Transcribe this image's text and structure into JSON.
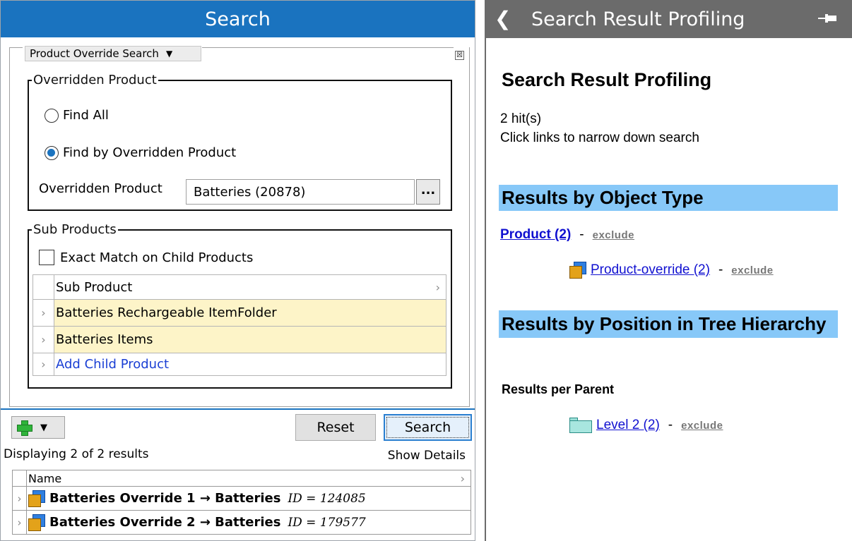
{
  "search_panel": {
    "header_title": "Search",
    "query_type": "Product Override Search",
    "close_glyph": "☒",
    "overridden_group": {
      "legend": "Overridden Product",
      "find_all_label": "Find All",
      "find_by_label": "Find by Overridden Product",
      "selected_option": "Find by Overridden Product",
      "field_label": "Overridden Product",
      "field_value": "Batteries (20878)",
      "browse_label": "..."
    },
    "sub_products_group": {
      "legend": "Sub Products",
      "exact_match_label": "Exact Match on Child Products",
      "exact_match_checked": false,
      "table_header": "Sub Product",
      "rows": [
        {
          "name": "Batteries Rechargeable ItemFolder"
        },
        {
          "name": "Batteries Items"
        }
      ],
      "add_child_label": "Add Child Product"
    },
    "toolbar": {
      "reset_label": "Reset",
      "search_label": "Search"
    },
    "results_count": "Displaying 2 of 2 results",
    "show_details_label": "Show Details",
    "results_table": {
      "header": "Name",
      "rows": [
        {
          "name": "Batteries Override 1 → Batteries",
          "id": "ID = 124085"
        },
        {
          "name": "Batteries Override 2 → Batteries",
          "id": "ID = 179577"
        }
      ]
    }
  },
  "profiling_panel": {
    "header_title": "Search Result Profiling",
    "title": "Search Result Profiling",
    "hits": "2 hit(s)",
    "hint": "Click links to narrow down search",
    "section_object_type": "Results by Object Type",
    "object_type_link": "Product (2)",
    "object_type_sub_link": "Product-override (2)",
    "section_position": "Results by Position in Tree Hierarchy",
    "results_per_parent": "Results per Parent",
    "parent_link": "Level 2 (2)",
    "dash": "-",
    "exclude_label": "exclude"
  },
  "colors": {
    "search_header": "#1a73bf",
    "profiling_header": "#6b6b6b",
    "section_band": "#87c8f8",
    "highlight_row": "#fdf4c8"
  },
  "icons": [
    "chevron-left-icon",
    "pin-icon",
    "add-icon",
    "product-override-icon",
    "folder-icon",
    "close-icon"
  ]
}
